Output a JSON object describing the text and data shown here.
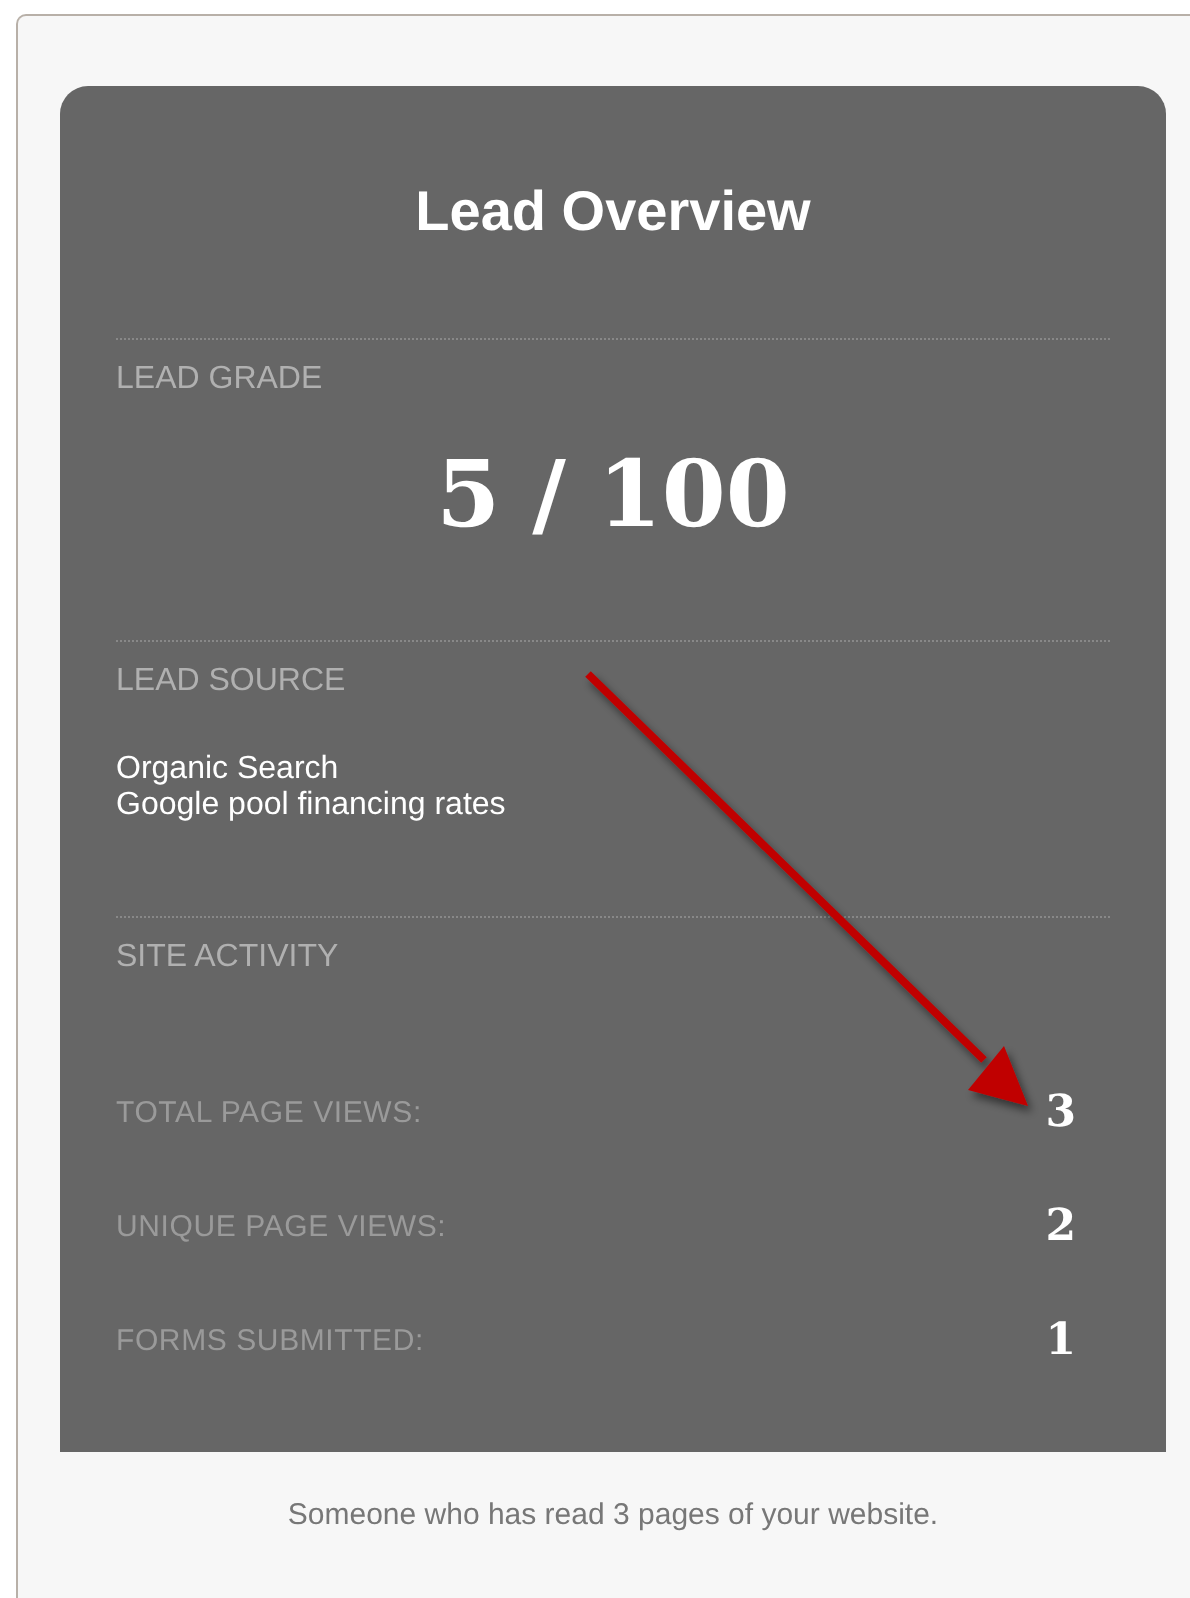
{
  "card": {
    "title": "Lead Overview",
    "sections": [
      {
        "kind": "grade",
        "heading": "LEAD GRADE",
        "value": "5 / 100"
      },
      {
        "kind": "lines",
        "heading": "LEAD SOURCE",
        "lines": [
          "Organic Search",
          "Google pool financing rates"
        ]
      },
      {
        "kind": "stats",
        "heading": "SITE ACTIVITY",
        "stats": [
          {
            "label": "TOTAL PAGE VIEWS:",
            "value": "3"
          },
          {
            "label": "UNIQUE PAGE VIEWS:",
            "value": "2"
          },
          {
            "label": "FORMS SUBMITTED:",
            "value": "1"
          }
        ]
      }
    ]
  },
  "caption": "Someone who has read 3 pages of your website."
}
